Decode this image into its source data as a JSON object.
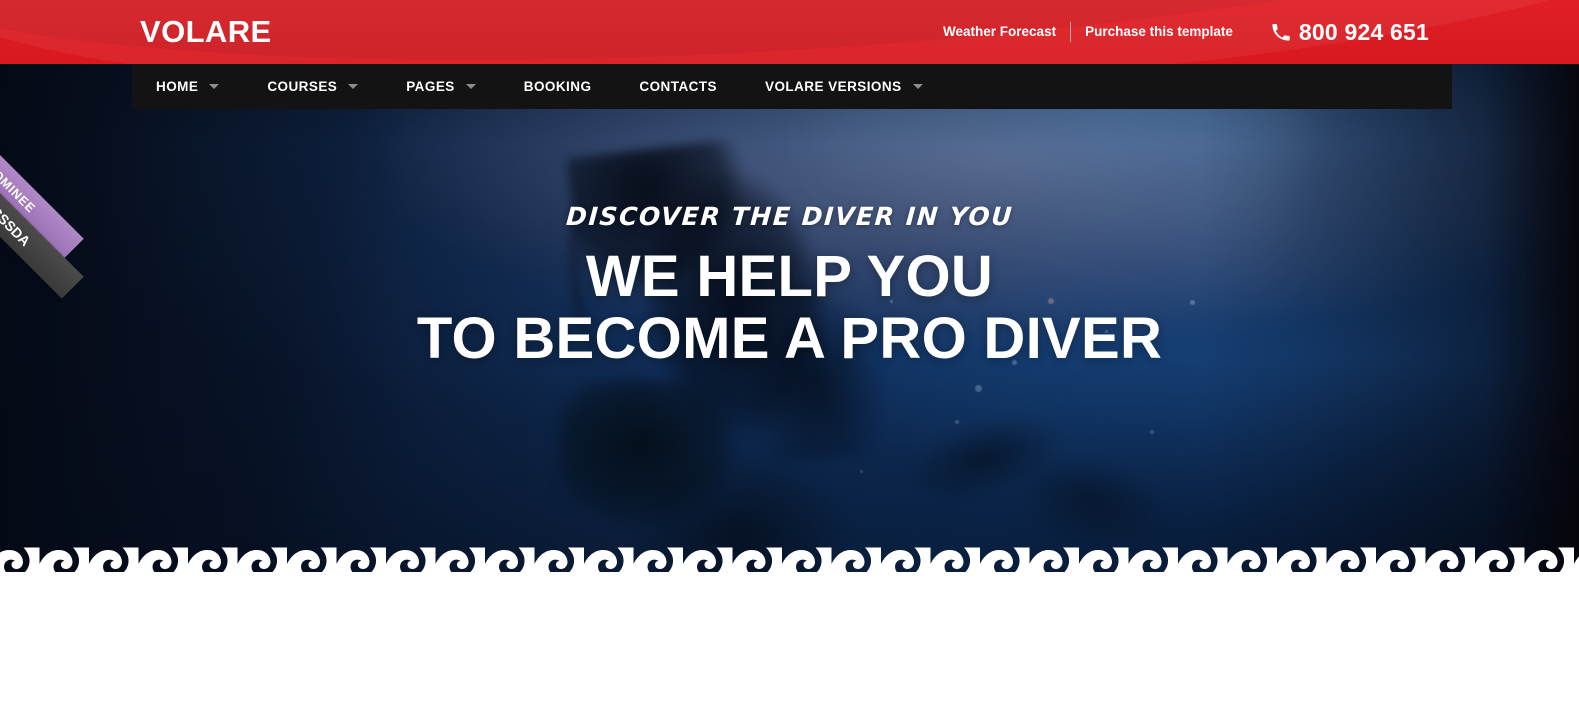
{
  "site": {
    "brand": "VOLARE",
    "accent_red": "#d8191f",
    "nav_bg": "#131313",
    "hero_dark": "#081428"
  },
  "topbar": {
    "links": [
      {
        "label": "Weather Forecast"
      },
      {
        "label": "Purchase this template"
      }
    ],
    "phone": {
      "icon": "phone-icon",
      "number": "800 924 651"
    }
  },
  "nav": {
    "items": [
      {
        "label": "HOME",
        "has_dropdown": true
      },
      {
        "label": "COURSES",
        "has_dropdown": true
      },
      {
        "label": "PAGES",
        "has_dropdown": true
      },
      {
        "label": "BOOKING",
        "has_dropdown": false
      },
      {
        "label": "CONTACTS",
        "has_dropdown": false
      },
      {
        "label": "VOLARE VERSIONS",
        "has_dropdown": true
      }
    ]
  },
  "ribbon": {
    "award": "NOMINEE",
    "organization": "CSSDA",
    "nominee_color": "#9a6fb4",
    "org_color": "#3a3a3a"
  },
  "hero": {
    "subtitle": "DISCOVER THE DIVER IN YOU",
    "title_line_1": "WE HELP YOU",
    "title_line_2": "TO BECOME A PRO DIVER"
  }
}
